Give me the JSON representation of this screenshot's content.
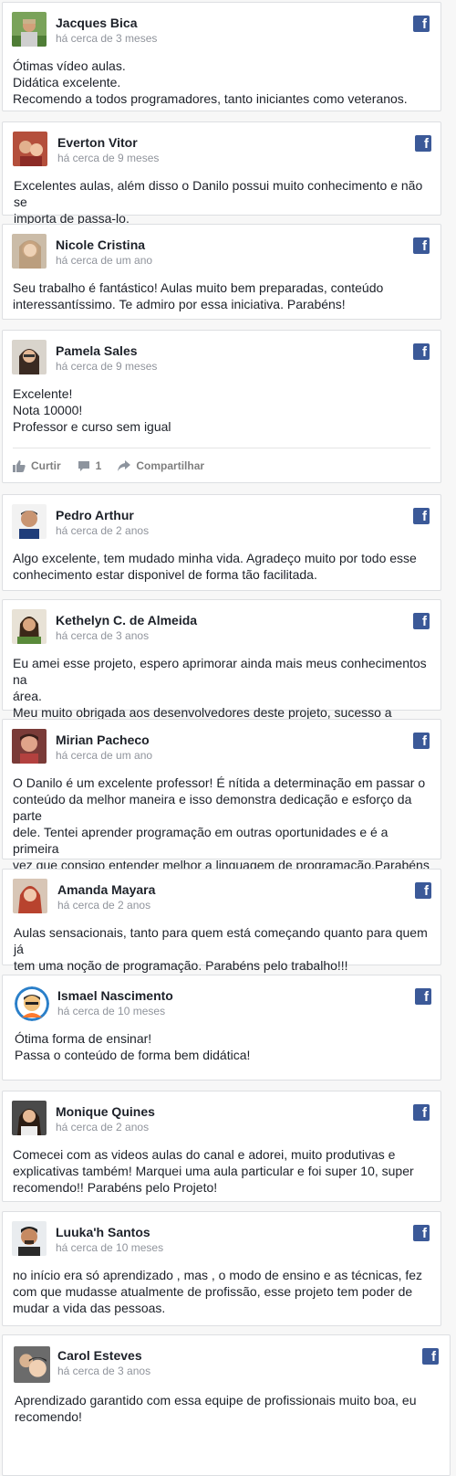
{
  "brand_color": "#3b5998",
  "icons": {
    "platform": "facebook-icon",
    "like": "thumbs-up-icon",
    "comment": "comment-icon",
    "share": "share-arrow-icon"
  },
  "reviews": [
    {
      "name": "Jacques Bica",
      "time": "há cerca de 3 meses",
      "text": "Ótimas vídeo aulas.\nDidática excelente.\nRecomendo a todos programadores, tanto iniciantes como veteranos."
    },
    {
      "name": "Everton Vitor",
      "time": "há cerca de 9 meses",
      "text": "Excelentes aulas, além disso o Danilo possui muito conhecimento e não se\nimporta de passa-lo."
    },
    {
      "name": "Nicole Cristina",
      "time": "há cerca de um ano",
      "text": "Seu trabalho é fantástico! Aulas muito bem preparadas, conteúdo\ninteressantíssimo. Te admiro por essa iniciativa. Parabéns!"
    },
    {
      "name": "Pamela Sales",
      "time": "há cerca de 9 meses",
      "text": "Excelente!\nNota 10000!\nProfessor e curso sem igual",
      "actions": {
        "like": "Curtir",
        "comment_count": "1",
        "share": "Compartilhar"
      }
    },
    {
      "name": "Pedro Arthur",
      "time": "há cerca de 2 anos",
      "text": "Algo excelente, tem mudado minha vida. Agradeço muito por todo esse\nconhecimento estar disponivel de forma tão facilitada."
    },
    {
      "name": "Kethelyn C. de Almeida",
      "time": "há cerca de 3 anos",
      "text": "Eu amei esse projeto, espero aprimorar ainda mais meus conhecimentos na\nárea.\nMeu muito obrigada aos desenvolvedores deste projeto, sucesso a todos!!"
    },
    {
      "name": "Mirian Pacheco",
      "time": "há cerca de um ano",
      "text": "O Danilo é um excelente professor! É nítida a determinação em passar o\nconteúdo da melhor maneira e isso demonstra dedicação e esforço da parte\ndele. Tentei aprender programação em outras oportunidades e é a primeira\nvez que consigo entender melhor a linguagem de programação.Parabéns e\nmuito obrigada!"
    },
    {
      "name": "Amanda Mayara",
      "time": "há cerca de 2 anos",
      "text": "Aulas sensacionais, tanto para quem está começando quanto para quem já\ntem uma noção de programação. Parabéns pelo trabalho!!!"
    },
    {
      "name": "Ismael Nascimento",
      "time": "há cerca de 10 meses",
      "text": "Ótima forma de ensinar!\nPassa o conteúdo de forma bem didática!"
    },
    {
      "name": "Monique Quines",
      "time": "há cerca de 2 anos",
      "text": "Comecei com as videos aulas do canal e adorei, muito produtivas e\nexplicativas também! Marquei uma aula particular e foi super 10, super\nrecomendo!! Parabéns pelo Projeto!"
    },
    {
      "name": "Luuka'h Santos",
      "time": "há cerca de 10 meses",
      "text": "no início era só aprendizado , mas , o modo de ensino e as técnicas, fez\ncom que mudasse atualmente de profissão, esse projeto tem poder de\nmudar a vida das pessoas."
    },
    {
      "name": "Carol Esteves",
      "time": "há cerca de 3 anos",
      "text": "Aprendizado garantido com essa equipe de profissionais muito boa, eu\nrecomendo!"
    }
  ]
}
